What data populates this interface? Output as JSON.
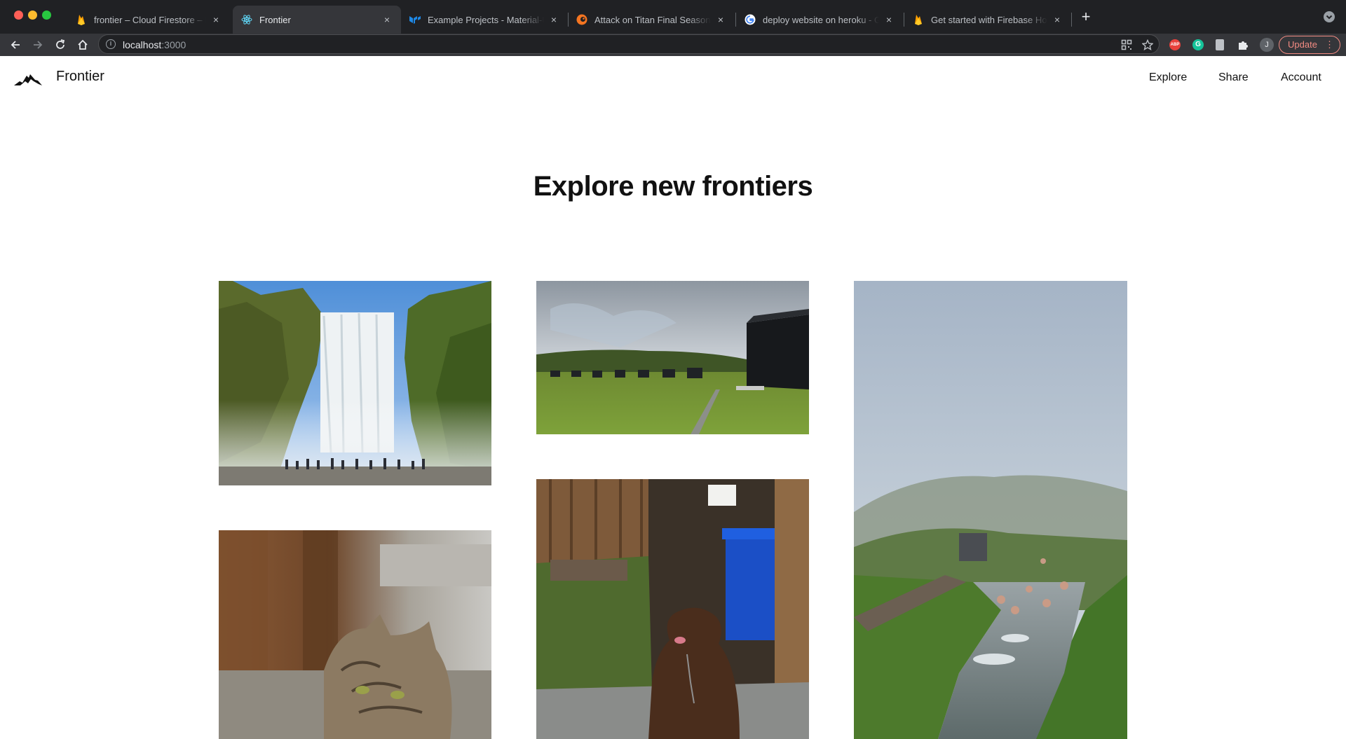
{
  "browser": {
    "tabs": [
      {
        "title": "frontier – Cloud Firestore – Fire",
        "favicon": "firebase-icon",
        "active": false
      },
      {
        "title": "Frontier",
        "favicon": "react-icon",
        "active": true
      },
      {
        "title": "Example Projects - Material-UI",
        "favicon": "material-ui-icon",
        "active": false
      },
      {
        "title": "Attack on Titan Final Season Ep",
        "favicon": "crunchyroll-icon",
        "active": false
      },
      {
        "title": "deploy website on heroku - Go",
        "favicon": "google-icon",
        "active": false
      },
      {
        "title": "Get started with Firebase Hosti",
        "favicon": "firebase-icon",
        "active": false
      }
    ],
    "close_glyph": "×",
    "new_tab_glyph": "+",
    "address": {
      "host": "localhost",
      "port": ":3000"
    },
    "extensions": {
      "abp": "ABP",
      "grammarly": "G"
    },
    "profile_initial": "J",
    "update_label": "Update",
    "menu_glyph": "⋮"
  },
  "app": {
    "brand": "Frontier",
    "nav": {
      "explore": "Explore",
      "share": "Share",
      "account": "Account"
    },
    "hero_title": "Explore new frontiers",
    "photos": [
      {
        "subject": "waterfall"
      },
      {
        "subject": "grassland-cabins"
      },
      {
        "subject": "hot-spring-river"
      },
      {
        "subject": "cat"
      },
      {
        "subject": "brown-dog"
      }
    ]
  },
  "colors": {
    "tab_bar": "#202124",
    "toolbar": "#35363a",
    "update_accent": "#f28b82",
    "page_background": "#ffffff",
    "text": "#111111"
  }
}
